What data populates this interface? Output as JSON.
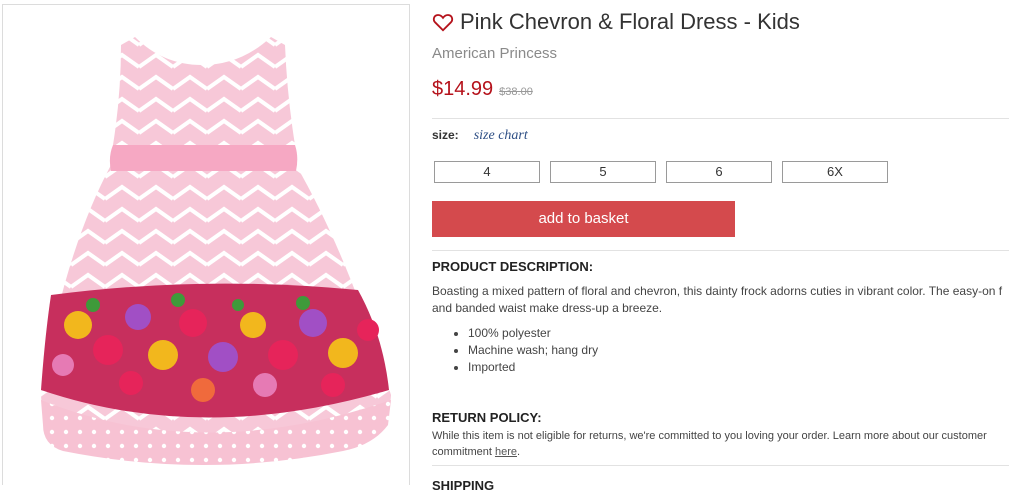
{
  "product": {
    "title": "Pink Chevron & Floral Dress - Kids",
    "brand": "American Princess",
    "price": "$14.99",
    "original_price": "$38.00"
  },
  "size": {
    "label": "size:",
    "chart_link": "size chart",
    "options": [
      "4",
      "5",
      "6",
      "6X"
    ]
  },
  "cta": {
    "add_to_basket": "add to basket"
  },
  "description": {
    "heading": "PRODUCT DESCRIPTION:",
    "body": "Boasting a mixed pattern of floral and chevron, this dainty frock adorns cuties in vibrant color. The easy-on f and banded waist make dress-up a breeze.",
    "bullets": [
      "100% polyester",
      "Machine wash; hang dry",
      "Imported"
    ]
  },
  "return_policy": {
    "heading": "RETURN POLICY:",
    "body": "While this item is not eligible for returns, we're committed to you loving your order. Learn more about our customer commitment ",
    "link": "here",
    "suffix": "."
  },
  "shipping": {
    "heading": "SHIPPING"
  },
  "icons": {
    "favorite": "heart-outline-icon"
  },
  "colors": {
    "price": "#b5121b",
    "button": "#d44a4d",
    "link": "#2e4f85",
    "dress_pink": "#f6c7d6"
  }
}
